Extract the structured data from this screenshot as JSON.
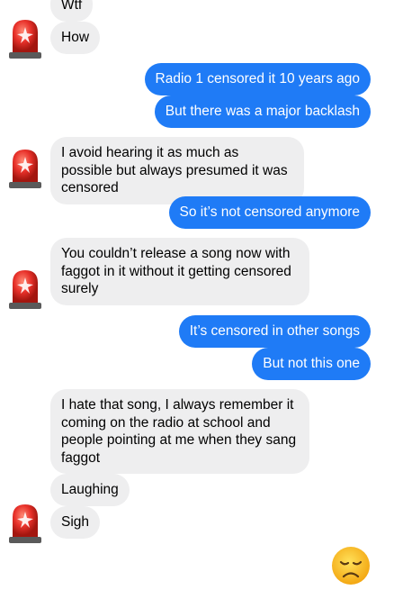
{
  "messages": [
    {
      "id": "m0",
      "side": "in",
      "text": "Wtf"
    },
    {
      "id": "m1",
      "side": "in",
      "text": "How"
    },
    {
      "id": "m2",
      "side": "out",
      "text": "Radio 1 censored it 10 years ago"
    },
    {
      "id": "m3",
      "side": "out",
      "text": "But there was a major backlash"
    },
    {
      "id": "m4",
      "side": "in",
      "text": "I avoid hearing it as much as possible but always presumed it was censored"
    },
    {
      "id": "m5",
      "side": "out",
      "text": "So it’s not censored anymore"
    },
    {
      "id": "m6",
      "side": "in",
      "text": "You couldn’t release a song now with faggot in it without it getting censored surely"
    },
    {
      "id": "m7",
      "side": "out",
      "text": "It’s censored in other songs"
    },
    {
      "id": "m8",
      "side": "out",
      "text": "But not this one"
    },
    {
      "id": "m9",
      "side": "in",
      "text": "I hate that song, I always remember it coming on the radio at school and people pointing at me when they sang faggot"
    },
    {
      "id": "m10",
      "side": "in",
      "text": "Laughing"
    },
    {
      "id": "m11",
      "side": "in",
      "text": "Sigh"
    }
  ],
  "colors": {
    "incoming_bubble": "#eeeeef",
    "outgoing_bubble": "#1f7bf6",
    "siren_red": "#e8312a"
  },
  "icons": {
    "avatar": "police-siren-icon",
    "reaction": "disappointed-face-emoji"
  }
}
